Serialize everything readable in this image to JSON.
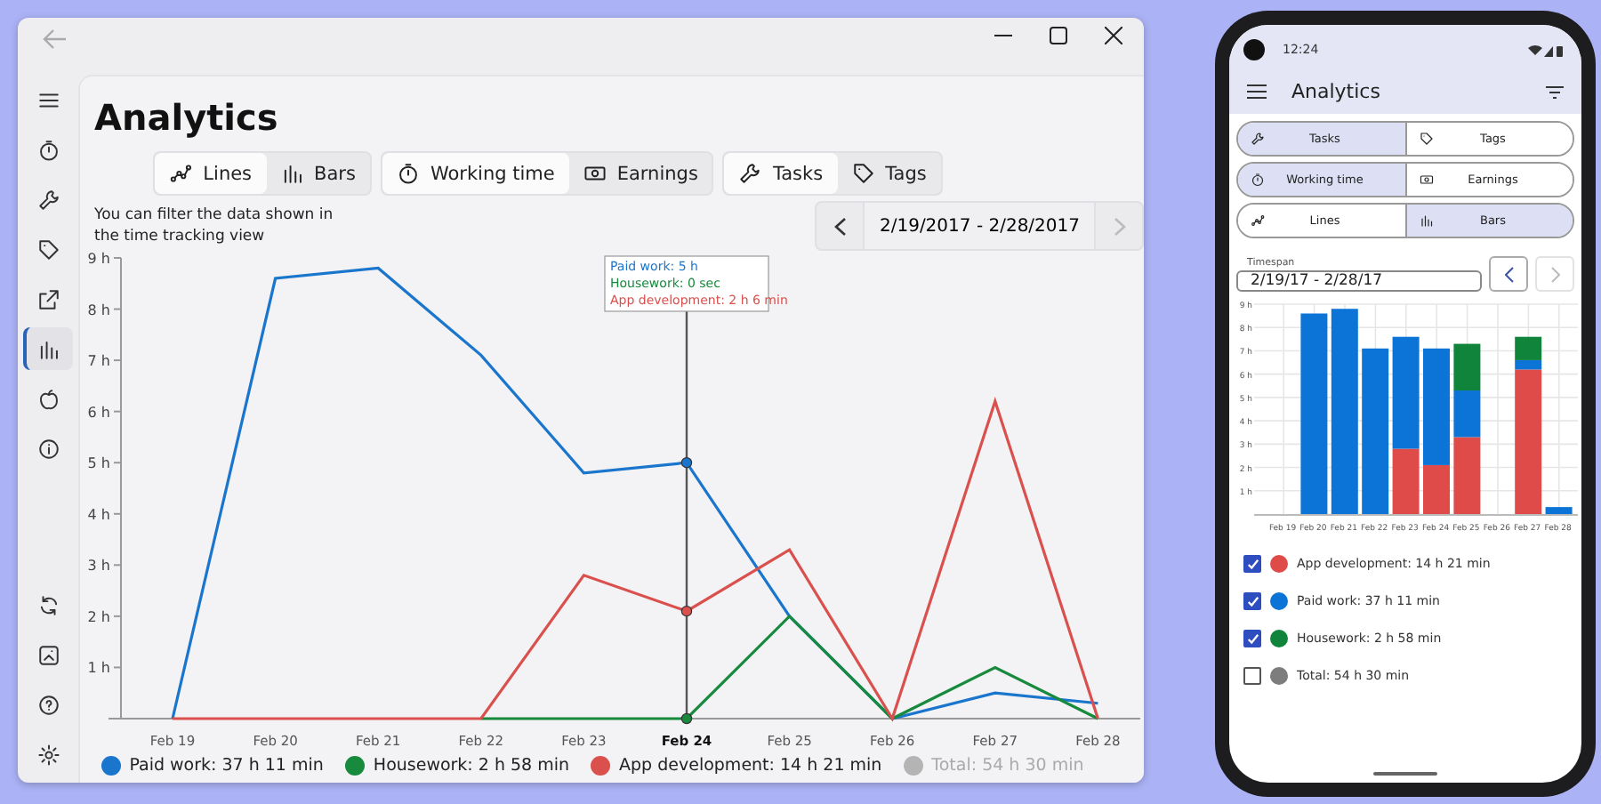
{
  "desktop": {
    "sidebar": {
      "items": [
        {
          "selected": false
        },
        {
          "selected": false
        },
        {
          "selected": false
        },
        {
          "selected": false
        },
        {
          "selected": false
        },
        {
          "selected": true
        },
        {
          "selected": false
        },
        {
          "selected": false
        }
      ],
      "bottom_items": [
        {
          "selected": false
        },
        {
          "selected": false
        },
        {
          "selected": false
        },
        {
          "selected": false
        }
      ]
    },
    "title": "Analytics",
    "toggle_groups": [
      [
        {
          "label": "Lines",
          "selected": true
        },
        {
          "label": "Bars",
          "selected": false
        }
      ],
      [
        {
          "label": "Working time",
          "selected": true
        },
        {
          "label": "Earnings",
          "selected": false
        }
      ],
      [
        {
          "label": "Tasks",
          "selected": true
        },
        {
          "label": "Tags",
          "selected": false
        }
      ]
    ],
    "filter_note": "You can filter the data shown in the time tracking view",
    "date_range": {
      "label": "2/19/2017 - 2/28/2017",
      "prev": {
        "disabled": false
      },
      "next": {
        "disabled": true
      }
    },
    "chart": {
      "chart_data": {
        "type": "line",
        "categories": [
          "Feb 19",
          "Feb 20",
          "Feb 21",
          "Feb 22",
          "Feb 23",
          "Feb 24",
          "Feb 25",
          "Feb 26",
          "Feb 27",
          "Feb 28"
        ],
        "series": [
          {
            "color": "#1a75cc",
            "values": [
              0,
              8.6,
              8.8,
              7.1,
              4.8,
              5,
              2,
              0,
              0.5,
              0.3
            ]
          },
          {
            "color": "#178a3e",
            "values": [
              null,
              null,
              null,
              0,
              0,
              0,
              2,
              0,
              1,
              0
            ]
          },
          {
            "color": "#d9504d",
            "values": [
              0,
              0,
              0,
              0,
              2.8,
              2.1,
              3.3,
              0,
              6.2,
              0
            ]
          }
        ],
        "ylim": [
          0,
          9
        ],
        "yticks": [
          {
            "value": 1,
            "label": "1 h"
          },
          {
            "value": 2,
            "label": "2 h"
          },
          {
            "value": 3,
            "label": "3 h"
          },
          {
            "value": 4,
            "label": "4 h"
          },
          {
            "value": 5,
            "label": "5 h"
          },
          {
            "value": 6,
            "label": "6 h"
          },
          {
            "value": 7,
            "label": "7 h"
          },
          {
            "value": 8,
            "label": "8 h"
          },
          {
            "value": 9,
            "label": "9 h"
          }
        ]
      },
      "hover": {
        "day": "Feb 24",
        "lines": [
          "Paid work: 5 h",
          "Housework: 0 sec",
          "App development: 2 h 6 min"
        ]
      }
    },
    "legend": [
      {
        "label": "Paid work: 37 h 11 min",
        "color": "#1a75cc",
        "on": true
      },
      {
        "label": "Housework: 2 h 58 min",
        "color": "#178a3e",
        "on": true
      },
      {
        "label": "App development: 14 h 21 min",
        "color": "#d9504d",
        "on": true
      },
      {
        "label": "Total: 54 h 30 min",
        "color": "#b4b4b4",
        "on": false
      }
    ]
  },
  "phone": {
    "status_bar": {
      "time": "12:24"
    },
    "title": "Analytics",
    "toggle_rows": [
      [
        {
          "label": "Tasks",
          "selected": true
        },
        {
          "label": "Tags",
          "selected": false
        }
      ],
      [
        {
          "label": "Working time",
          "selected": true
        },
        {
          "label": "Earnings",
          "selected": false
        }
      ],
      [
        {
          "label": "Lines",
          "selected": false
        },
        {
          "label": "Bars",
          "selected": true
        }
      ]
    ],
    "timespan": {
      "label": "Timespan",
      "value": "2/19/17 - 2/28/17",
      "prev": {
        "disabled": false
      },
      "next": {
        "disabled": true
      }
    },
    "chart": {
      "chart_data": {
        "type": "bar",
        "stacked": true,
        "categories": [
          "Feb 19",
          "Feb 20",
          "Feb 21",
          "Feb 22",
          "Feb 23",
          "Feb 24",
          "Feb 25",
          "Feb 26",
          "Feb 27",
          "Feb 28"
        ],
        "series": [
          {
            "color": "#df4b48",
            "values": [
              0,
              0,
              0,
              0,
              2.8,
              2.1,
              3.3,
              0,
              6.2,
              0
            ]
          },
          {
            "color": "#0b74d6",
            "values": [
              0,
              8.6,
              8.8,
              7.1,
              4.8,
              5,
              2,
              0,
              0.4,
              0.3
            ]
          },
          {
            "color": "#11843c",
            "values": [
              0,
              0,
              0,
              0,
              0,
              0,
              2,
              0,
              1,
              0
            ]
          }
        ],
        "ylim": [
          0,
          9
        ],
        "grid": true,
        "yticks": [
          {
            "value": 1,
            "label": "1 h"
          },
          {
            "value": 2,
            "label": "2 h"
          },
          {
            "value": 3,
            "label": "3 h"
          },
          {
            "value": 4,
            "label": "4 h"
          },
          {
            "value": 5,
            "label": "5 h"
          },
          {
            "value": 6,
            "label": "6 h"
          },
          {
            "value": 7,
            "label": "7 h"
          },
          {
            "value": 8,
            "label": "8 h"
          },
          {
            "value": 9,
            "label": "9 h"
          }
        ]
      }
    },
    "legend": [
      {
        "label": "App development: 14 h 21 min",
        "color": "#df4b48",
        "checked": true
      },
      {
        "label": "Paid work: 37 h 11 min",
        "color": "#0b74d6",
        "checked": true
      },
      {
        "label": "Housework: 2 h 58 min",
        "color": "#11843c",
        "checked": true
      },
      {
        "label": "Total: 54 h 30 min",
        "color": "#7d7d7d",
        "checked": false
      }
    ]
  }
}
